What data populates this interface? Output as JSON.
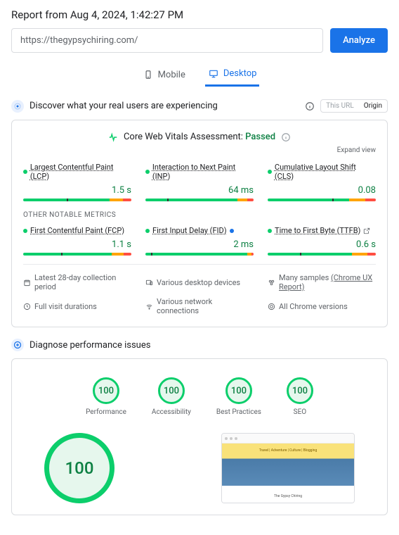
{
  "title": "Report from Aug 4, 2024, 1:42:27 PM",
  "url_value": "https://thegypsychiring.com/",
  "analyze_label": "Analyze",
  "tabs": {
    "mobile": "Mobile",
    "desktop": "Desktop"
  },
  "discover": {
    "title": "Discover what your real users are experiencing",
    "toggle_url": "This URL",
    "toggle_origin": "Origin"
  },
  "cwv": {
    "label": "Core Web Vitals Assessment:",
    "status": "Passed",
    "expand": "Expand view"
  },
  "metrics": [
    {
      "label": "Largest Contentful Paint (LCP)",
      "value": "1.5 s",
      "g": 80,
      "o": 12,
      "r": 8,
      "mark": 40
    },
    {
      "label": "Interaction to Next Paint (INP)",
      "value": "64 ms",
      "g": 85,
      "o": 9,
      "r": 6,
      "mark": 20
    },
    {
      "label": "Cumulative Layout Shift (CLS)",
      "value": "0.08",
      "g": 75,
      "o": 15,
      "r": 10,
      "mark": 60
    }
  ],
  "other_label": "OTHER NOTABLE METRICS",
  "other_metrics": [
    {
      "label": "First Contentful Paint (FCP)",
      "value": "1.1 s",
      "g": 82,
      "o": 11,
      "r": 7,
      "mark": 35,
      "blue": false,
      "share": false
    },
    {
      "label": "First Input Delay (FID)",
      "value": "2 ms",
      "g": 94,
      "o": 4,
      "r": 2,
      "mark": 5,
      "blue": true,
      "share": false
    },
    {
      "label": "Time to First Byte (TTFB)",
      "value": "0.6 s",
      "g": 78,
      "o": 14,
      "r": 8,
      "mark": 30,
      "blue": false,
      "share": true
    }
  ],
  "notes": {
    "period": "Latest 28-day collection period",
    "devices": "Various desktop devices",
    "samples": "Many samples",
    "samples_link": "(Chrome UX Report)",
    "durations": "Full visit durations",
    "network": "Various network connections",
    "versions": "All Chrome versions"
  },
  "diagnose": {
    "title": "Diagnose performance issues"
  },
  "scores": [
    {
      "value": "100",
      "label": "Performance"
    },
    {
      "value": "100",
      "label": "Accessibility"
    },
    {
      "value": "100",
      "label": "Best Practices"
    },
    {
      "value": "100",
      "label": "SEO"
    }
  ],
  "big_score": "100",
  "preview": {
    "banner": "Travel | Adventure | Culture | Blogging",
    "caption": "The Gypsy Chiring"
  }
}
